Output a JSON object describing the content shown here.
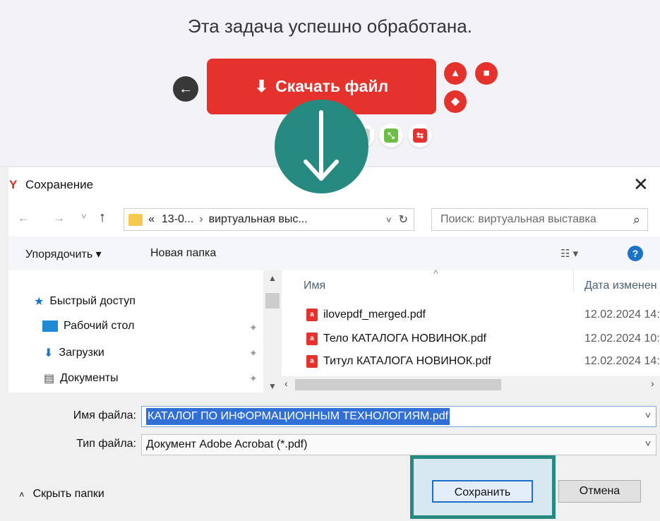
{
  "web": {
    "title": "Эта задача успешно обработана.",
    "download_label": "Скачать файл",
    "back_glyph": "←",
    "download_glyph": "⬇",
    "down_arrow_glyph": "↓"
  },
  "dialog": {
    "title": "Сохранение",
    "app_glyph": "Y",
    "close_glyph": "✕",
    "nav": {
      "back": "←",
      "forward": "→",
      "recent": "˅",
      "up": "↑"
    },
    "path": {
      "prefix": "«",
      "segment1": "13-0...",
      "separator": "›",
      "segment2": "виртуальная выс...",
      "dropdown": "˅",
      "refresh": "↻"
    },
    "search_placeholder": "Поиск: виртуальная выставка",
    "search_glyph": "⌕",
    "toolbar": {
      "organize": "Упорядочить ▾",
      "new_folder": "Новая папка",
      "views_glyph": "☷ ▾",
      "help_glyph": "?"
    },
    "nav_items": [
      {
        "label": "Быстрый доступ",
        "icon": "star-icon",
        "glyph": "★"
      },
      {
        "label": "Рабочий стол",
        "icon": "desktop-icon",
        "glyph": ""
      },
      {
        "label": "Загрузки",
        "icon": "download-icon",
        "glyph": "⬇"
      },
      {
        "label": "Документы",
        "icon": "documents-icon",
        "glyph": "▤"
      }
    ],
    "pin_glyph": "📌",
    "columns": {
      "name": "Имя",
      "date": "Дата изменен",
      "sort_glyph": "^"
    },
    "files": [
      {
        "name": "ilovepdf_merged.pdf",
        "date": "12.02.2024 14:"
      },
      {
        "name": "Тело КАТАЛОГА НОВИНОК.pdf",
        "date": "12.02.2024 10:"
      },
      {
        "name": "Титул КАТАЛОГА НОВИНОК.pdf",
        "date": "12.02.2024 14:"
      }
    ],
    "file_name_label": "Имя файла:",
    "file_name_value": "КАТАЛОГ ПО ИНФОРМАЦИОННЫМ ТЕХНОЛОГИЯМ.pdf",
    "file_type_label": "Тип файла:",
    "file_type_value": "Документ Adobe Acrobat (*.pdf)",
    "hide_folders": "Скрыть папки",
    "save_label": "Сохранить",
    "cancel_label": "Отмена"
  },
  "colors": {
    "accent_red": "#e5322d",
    "teal": "#268a80",
    "selection_blue": "#2f6fd6"
  }
}
